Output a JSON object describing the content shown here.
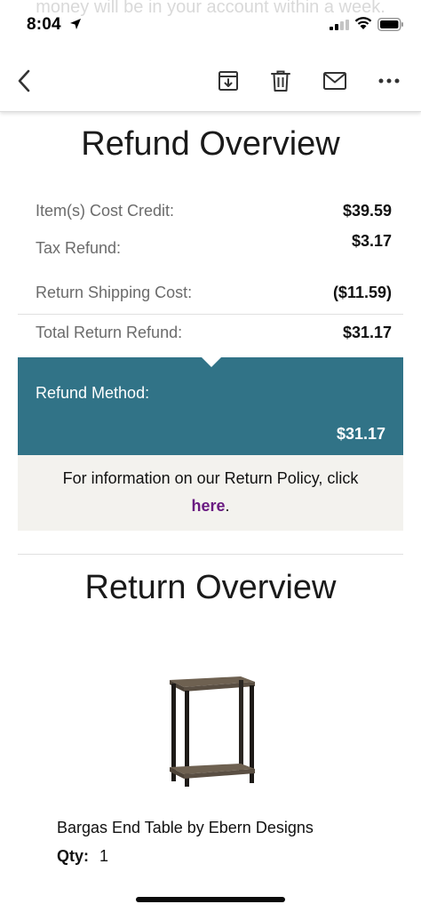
{
  "status_bar": {
    "time": "8:04",
    "background_text": "money will be in your account within a week."
  },
  "toolbar": {
    "icons": [
      "back-icon",
      "archive-icon",
      "trash-icon",
      "mail-icon",
      "more-icon"
    ]
  },
  "refund_overview": {
    "title": "Refund Overview",
    "rows": [
      {
        "label": "Item(s) Cost Credit:",
        "value": "$39.59"
      },
      {
        "label": "Tax Refund:",
        "value": "$3.17"
      },
      {
        "label": "Return Shipping Cost:",
        "value": "($11.59)"
      },
      {
        "label": "Total Return Refund:",
        "value": "$31.17"
      }
    ],
    "method_label": "Refund Method:",
    "method_amount": "$31.17",
    "policy_text": "For information on our Return Policy, click",
    "policy_link": "here",
    "policy_end": "."
  },
  "return_overview": {
    "title": "Return Overview",
    "product_name": "Bargas End Table by Ebern Designs",
    "qty_label": "Qty:",
    "qty_value": "1"
  },
  "colors": {
    "method_bg": "#317387",
    "policy_bg": "#f3f2ee",
    "link": "#6a1b82"
  }
}
